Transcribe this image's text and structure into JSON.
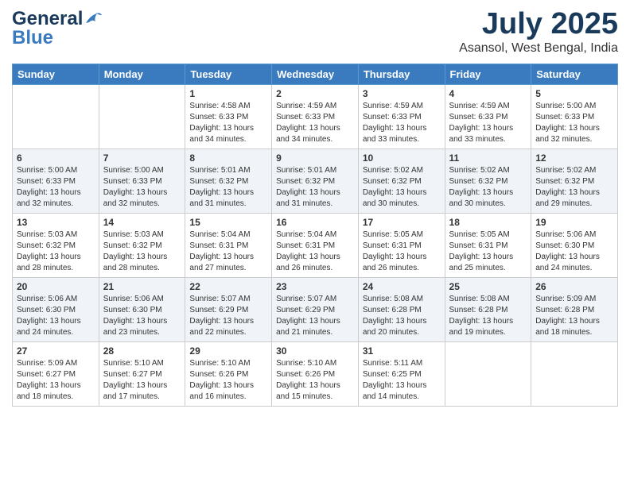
{
  "header": {
    "logo_line1": "General",
    "logo_line2": "Blue",
    "month": "July 2025",
    "location": "Asansol, West Bengal, India"
  },
  "columns": [
    "Sunday",
    "Monday",
    "Tuesday",
    "Wednesday",
    "Thursday",
    "Friday",
    "Saturday"
  ],
  "weeks": [
    [
      {
        "day": "",
        "sunrise": "",
        "sunset": "",
        "daylight": ""
      },
      {
        "day": "",
        "sunrise": "",
        "sunset": "",
        "daylight": ""
      },
      {
        "day": "1",
        "sunrise": "Sunrise: 4:58 AM",
        "sunset": "Sunset: 6:33 PM",
        "daylight": "Daylight: 13 hours and 34 minutes."
      },
      {
        "day": "2",
        "sunrise": "Sunrise: 4:59 AM",
        "sunset": "Sunset: 6:33 PM",
        "daylight": "Daylight: 13 hours and 34 minutes."
      },
      {
        "day": "3",
        "sunrise": "Sunrise: 4:59 AM",
        "sunset": "Sunset: 6:33 PM",
        "daylight": "Daylight: 13 hours and 33 minutes."
      },
      {
        "day": "4",
        "sunrise": "Sunrise: 4:59 AM",
        "sunset": "Sunset: 6:33 PM",
        "daylight": "Daylight: 13 hours and 33 minutes."
      },
      {
        "day": "5",
        "sunrise": "Sunrise: 5:00 AM",
        "sunset": "Sunset: 6:33 PM",
        "daylight": "Daylight: 13 hours and 32 minutes."
      }
    ],
    [
      {
        "day": "6",
        "sunrise": "Sunrise: 5:00 AM",
        "sunset": "Sunset: 6:33 PM",
        "daylight": "Daylight: 13 hours and 32 minutes."
      },
      {
        "day": "7",
        "sunrise": "Sunrise: 5:00 AM",
        "sunset": "Sunset: 6:33 PM",
        "daylight": "Daylight: 13 hours and 32 minutes."
      },
      {
        "day": "8",
        "sunrise": "Sunrise: 5:01 AM",
        "sunset": "Sunset: 6:32 PM",
        "daylight": "Daylight: 13 hours and 31 minutes."
      },
      {
        "day": "9",
        "sunrise": "Sunrise: 5:01 AM",
        "sunset": "Sunset: 6:32 PM",
        "daylight": "Daylight: 13 hours and 31 minutes."
      },
      {
        "day": "10",
        "sunrise": "Sunrise: 5:02 AM",
        "sunset": "Sunset: 6:32 PM",
        "daylight": "Daylight: 13 hours and 30 minutes."
      },
      {
        "day": "11",
        "sunrise": "Sunrise: 5:02 AM",
        "sunset": "Sunset: 6:32 PM",
        "daylight": "Daylight: 13 hours and 30 minutes."
      },
      {
        "day": "12",
        "sunrise": "Sunrise: 5:02 AM",
        "sunset": "Sunset: 6:32 PM",
        "daylight": "Daylight: 13 hours and 29 minutes."
      }
    ],
    [
      {
        "day": "13",
        "sunrise": "Sunrise: 5:03 AM",
        "sunset": "Sunset: 6:32 PM",
        "daylight": "Daylight: 13 hours and 28 minutes."
      },
      {
        "day": "14",
        "sunrise": "Sunrise: 5:03 AM",
        "sunset": "Sunset: 6:32 PM",
        "daylight": "Daylight: 13 hours and 28 minutes."
      },
      {
        "day": "15",
        "sunrise": "Sunrise: 5:04 AM",
        "sunset": "Sunset: 6:31 PM",
        "daylight": "Daylight: 13 hours and 27 minutes."
      },
      {
        "day": "16",
        "sunrise": "Sunrise: 5:04 AM",
        "sunset": "Sunset: 6:31 PM",
        "daylight": "Daylight: 13 hours and 26 minutes."
      },
      {
        "day": "17",
        "sunrise": "Sunrise: 5:05 AM",
        "sunset": "Sunset: 6:31 PM",
        "daylight": "Daylight: 13 hours and 26 minutes."
      },
      {
        "day": "18",
        "sunrise": "Sunrise: 5:05 AM",
        "sunset": "Sunset: 6:31 PM",
        "daylight": "Daylight: 13 hours and 25 minutes."
      },
      {
        "day": "19",
        "sunrise": "Sunrise: 5:06 AM",
        "sunset": "Sunset: 6:30 PM",
        "daylight": "Daylight: 13 hours and 24 minutes."
      }
    ],
    [
      {
        "day": "20",
        "sunrise": "Sunrise: 5:06 AM",
        "sunset": "Sunset: 6:30 PM",
        "daylight": "Daylight: 13 hours and 24 minutes."
      },
      {
        "day": "21",
        "sunrise": "Sunrise: 5:06 AM",
        "sunset": "Sunset: 6:30 PM",
        "daylight": "Daylight: 13 hours and 23 minutes."
      },
      {
        "day": "22",
        "sunrise": "Sunrise: 5:07 AM",
        "sunset": "Sunset: 6:29 PM",
        "daylight": "Daylight: 13 hours and 22 minutes."
      },
      {
        "day": "23",
        "sunrise": "Sunrise: 5:07 AM",
        "sunset": "Sunset: 6:29 PM",
        "daylight": "Daylight: 13 hours and 21 minutes."
      },
      {
        "day": "24",
        "sunrise": "Sunrise: 5:08 AM",
        "sunset": "Sunset: 6:28 PM",
        "daylight": "Daylight: 13 hours and 20 minutes."
      },
      {
        "day": "25",
        "sunrise": "Sunrise: 5:08 AM",
        "sunset": "Sunset: 6:28 PM",
        "daylight": "Daylight: 13 hours and 19 minutes."
      },
      {
        "day": "26",
        "sunrise": "Sunrise: 5:09 AM",
        "sunset": "Sunset: 6:28 PM",
        "daylight": "Daylight: 13 hours and 18 minutes."
      }
    ],
    [
      {
        "day": "27",
        "sunrise": "Sunrise: 5:09 AM",
        "sunset": "Sunset: 6:27 PM",
        "daylight": "Daylight: 13 hours and 18 minutes."
      },
      {
        "day": "28",
        "sunrise": "Sunrise: 5:10 AM",
        "sunset": "Sunset: 6:27 PM",
        "daylight": "Daylight: 13 hours and 17 minutes."
      },
      {
        "day": "29",
        "sunrise": "Sunrise: 5:10 AM",
        "sunset": "Sunset: 6:26 PM",
        "daylight": "Daylight: 13 hours and 16 minutes."
      },
      {
        "day": "30",
        "sunrise": "Sunrise: 5:10 AM",
        "sunset": "Sunset: 6:26 PM",
        "daylight": "Daylight: 13 hours and 15 minutes."
      },
      {
        "day": "31",
        "sunrise": "Sunrise: 5:11 AM",
        "sunset": "Sunset: 6:25 PM",
        "daylight": "Daylight: 13 hours and 14 minutes."
      },
      {
        "day": "",
        "sunrise": "",
        "sunset": "",
        "daylight": ""
      },
      {
        "day": "",
        "sunrise": "",
        "sunset": "",
        "daylight": ""
      }
    ]
  ]
}
